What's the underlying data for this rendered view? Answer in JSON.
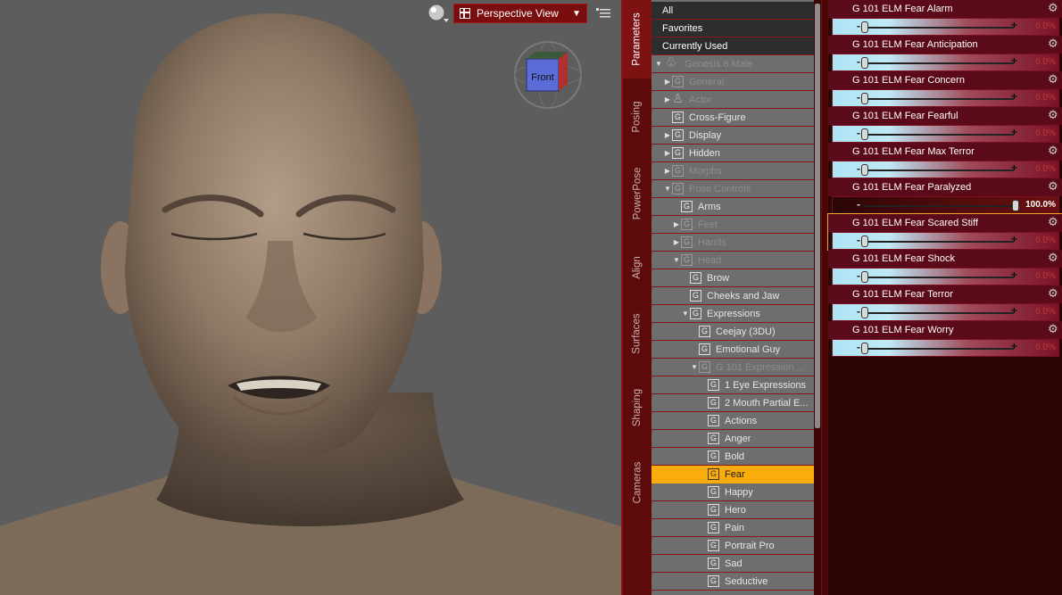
{
  "viewport": {
    "view_name": "Perspective View",
    "cube_label": "Front"
  },
  "tabs": [
    {
      "label": "Parameters",
      "active": true
    },
    {
      "label": "Posing",
      "active": false
    },
    {
      "label": "PowerPose",
      "active": false
    },
    {
      "label": "Align",
      "active": false
    },
    {
      "label": "Surfaces",
      "active": false
    },
    {
      "label": "Shaping",
      "active": false
    },
    {
      "label": "Cameras",
      "active": false
    }
  ],
  "tree": {
    "top_items": [
      "All",
      "Favorites",
      "Currently Used"
    ],
    "nodes": [
      {
        "label": "Genesis 8 Male",
        "indent": 0,
        "arrow": "down",
        "icon": "figure",
        "dim": true
      },
      {
        "label": "General",
        "indent": 1,
        "arrow": "right",
        "icon": "G",
        "dim": true
      },
      {
        "label": "Actor",
        "indent": 1,
        "arrow": "right",
        "icon": "person",
        "dim": true
      },
      {
        "label": "Cross-Figure",
        "indent": 1,
        "arrow": "",
        "icon": "G",
        "dim": false
      },
      {
        "label": "Display",
        "indent": 1,
        "arrow": "right",
        "icon": "G",
        "dim": false
      },
      {
        "label": "Hidden",
        "indent": 1,
        "arrow": "right",
        "icon": "G",
        "dim": false
      },
      {
        "label": "Morphs",
        "indent": 1,
        "arrow": "right",
        "icon": "G",
        "dim": true
      },
      {
        "label": "Pose Controls",
        "indent": 1,
        "arrow": "down",
        "icon": "G",
        "dim": true
      },
      {
        "label": "Arms",
        "indent": 2,
        "arrow": "",
        "icon": "G",
        "dim": false
      },
      {
        "label": "Feet",
        "indent": 2,
        "arrow": "right",
        "icon": "G",
        "dim": true
      },
      {
        "label": "Hands",
        "indent": 2,
        "arrow": "right",
        "icon": "G",
        "dim": true
      },
      {
        "label": "Head",
        "indent": 2,
        "arrow": "down",
        "icon": "G",
        "dim": true
      },
      {
        "label": "Brow",
        "indent": 3,
        "arrow": "",
        "icon": "G",
        "dim": false
      },
      {
        "label": "Cheeks and Jaw",
        "indent": 3,
        "arrow": "",
        "icon": "G",
        "dim": false
      },
      {
        "label": "Expressions",
        "indent": 3,
        "arrow": "down",
        "icon": "G",
        "dim": false
      },
      {
        "label": "Ceejay (3DU)",
        "indent": 4,
        "arrow": "",
        "icon": "G",
        "dim": false
      },
      {
        "label": "Emotional Guy",
        "indent": 4,
        "arrow": "",
        "icon": "G",
        "dim": false
      },
      {
        "label": "G 101 Expression ...",
        "indent": 4,
        "arrow": "down",
        "icon": "G",
        "dim": true
      },
      {
        "label": "1 Eye Expressions",
        "indent": 5,
        "arrow": "",
        "icon": "G",
        "dim": false
      },
      {
        "label": "2 Mouth Partial E...",
        "indent": 5,
        "arrow": "",
        "icon": "G",
        "dim": false
      },
      {
        "label": "Actions",
        "indent": 5,
        "arrow": "",
        "icon": "G",
        "dim": false
      },
      {
        "label": "Anger",
        "indent": 5,
        "arrow": "",
        "icon": "G",
        "dim": false
      },
      {
        "label": "Bold",
        "indent": 5,
        "arrow": "",
        "icon": "G",
        "dim": false
      },
      {
        "label": "Fear",
        "indent": 5,
        "arrow": "",
        "icon": "G",
        "dim": false,
        "selected": true
      },
      {
        "label": "Happy",
        "indent": 5,
        "arrow": "",
        "icon": "G",
        "dim": false
      },
      {
        "label": "Hero",
        "indent": 5,
        "arrow": "",
        "icon": "G",
        "dim": false
      },
      {
        "label": "Pain",
        "indent": 5,
        "arrow": "",
        "icon": "G",
        "dim": false
      },
      {
        "label": "Portrait Pro",
        "indent": 5,
        "arrow": "",
        "icon": "G",
        "dim": false
      },
      {
        "label": "Sad",
        "indent": 5,
        "arrow": "",
        "icon": "G",
        "dim": false
      },
      {
        "label": "Seductive",
        "indent": 5,
        "arrow": "",
        "icon": "G",
        "dim": false
      }
    ]
  },
  "params": [
    {
      "name": "G 101 ELM Fear Alarm",
      "value": "0.0%",
      "level": 0
    },
    {
      "name": "G 101 ELM Fear Anticipation",
      "value": "0.0%",
      "level": 0
    },
    {
      "name": "G 101 ELM Fear Concern",
      "value": "0.0%",
      "level": 0
    },
    {
      "name": "G 101 ELM Fear Fearful",
      "value": "0.0%",
      "level": 0
    },
    {
      "name": "G 101 ELM Fear Max Terror",
      "value": "0.0%",
      "level": 0
    },
    {
      "name": "G 101 ELM Fear Paralyzed",
      "value": "100.0%",
      "level": 1
    },
    {
      "name": "G 101 ELM Fear Scared Stiff",
      "value": "0.0%",
      "level": 0,
      "highlight": true
    },
    {
      "name": "G 101 ELM Fear Shock",
      "value": "0.0%",
      "level": 0
    },
    {
      "name": "G 101 ELM Fear Terror",
      "value": "0.0%",
      "level": 0
    },
    {
      "name": "G 101 ELM Fear Worry",
      "value": "0.0%",
      "level": 0
    }
  ],
  "colors": {
    "accent_red": "#7a0d0d",
    "selection": "#f8ad0d",
    "slider_light": "#aee4f4"
  }
}
